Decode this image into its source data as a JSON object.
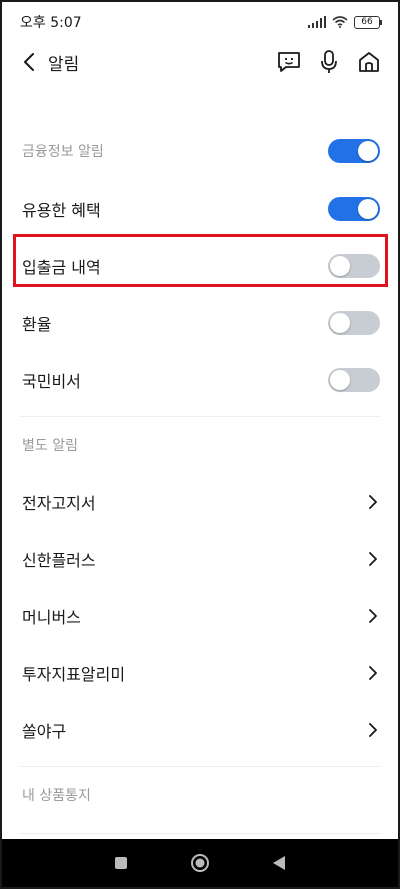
{
  "status_bar": {
    "time": "오후 5:07",
    "battery": "66"
  },
  "header": {
    "title": "알림"
  },
  "sections": {
    "financial": {
      "label": "금융정보 알림",
      "items": [
        {
          "label": "유용한 혜택",
          "toggle": "on"
        },
        {
          "label": "입출금 내역",
          "toggle": "off"
        },
        {
          "label": "환율",
          "toggle": "off"
        },
        {
          "label": "국민비서",
          "toggle": "off"
        }
      ],
      "master_toggle": "on"
    },
    "separate": {
      "label": "별도 알림",
      "items": [
        {
          "label": "전자고지서"
        },
        {
          "label": "신한플러스"
        },
        {
          "label": "머니버스"
        },
        {
          "label": "투자지표알리미"
        },
        {
          "label": "쏠야구"
        }
      ]
    },
    "product": {
      "label": "내 상품통지"
    }
  },
  "colors": {
    "toggle_on": "#2271e6",
    "toggle_off": "#c8cdd3",
    "highlight": "#e0141e"
  }
}
